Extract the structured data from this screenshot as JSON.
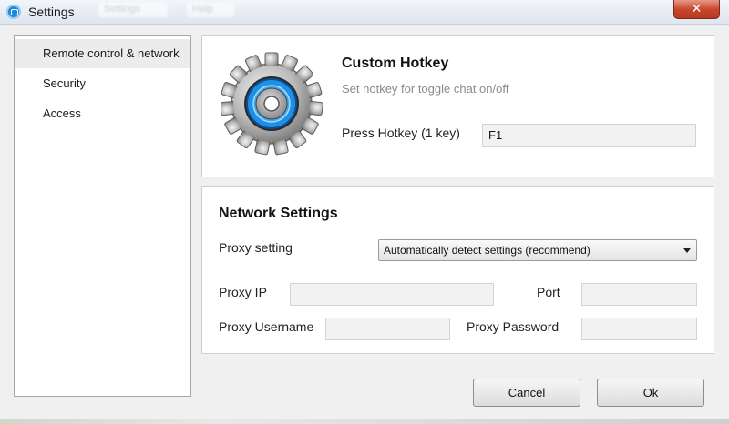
{
  "window": {
    "title": "Settings",
    "close_label": "✕"
  },
  "menu_ghosts": [
    "Settings",
    "Help"
  ],
  "sidebar": {
    "items": [
      {
        "label": "Remote control & network"
      },
      {
        "label": "Security"
      },
      {
        "label": "Access"
      }
    ]
  },
  "hotkey": {
    "title": "Custom Hotkey",
    "subtitle": "Set hotkey for toggle chat on/off",
    "press_label": "Press Hotkey (1 key)",
    "value": "F1"
  },
  "network": {
    "title": "Network Settings",
    "proxy_setting_label": "Proxy setting",
    "proxy_setting_value": "Automatically detect settings (recommend)",
    "proxy_ip_label": "Proxy IP",
    "port_label": "Port",
    "proxy_username_label": "Proxy Username",
    "proxy_password_label": "Proxy Password"
  },
  "buttons": {
    "cancel": "Cancel",
    "ok": "Ok"
  },
  "colors": {
    "accent_blue": "#1e88d9",
    "close_red": "#c9452c"
  }
}
